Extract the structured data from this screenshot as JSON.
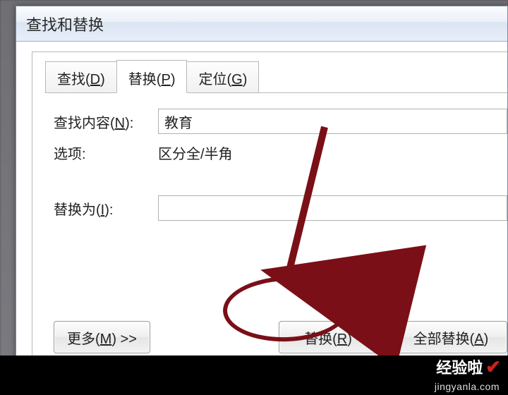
{
  "dialog": {
    "title": "查找和替换"
  },
  "tabs": {
    "find": {
      "label": "查找(",
      "key": "D",
      "close": ")"
    },
    "replace": {
      "label": "替换(",
      "key": "P",
      "close": ")"
    },
    "goto": {
      "label": "定位(",
      "key": "G",
      "close": ")"
    }
  },
  "form": {
    "find_label_pre": "查找内容(",
    "find_label_key": "N",
    "find_label_post": "):",
    "find_value": "教育",
    "options_label": "选项:",
    "options_value": "区分全/半角",
    "replace_label_pre": "替换为(",
    "replace_label_key": "I",
    "replace_label_post": "):",
    "replace_value": ""
  },
  "buttons": {
    "more_pre": "更多(",
    "more_key": "M",
    "more_post": ") >>",
    "replace_pre": "替换(",
    "replace_key": "R",
    "replace_post": ")",
    "all_pre": "全部替换(",
    "all_key": "A",
    "all_post": ")"
  },
  "watermark": {
    "brand": "经验啦",
    "url": "jingyanla.com"
  }
}
